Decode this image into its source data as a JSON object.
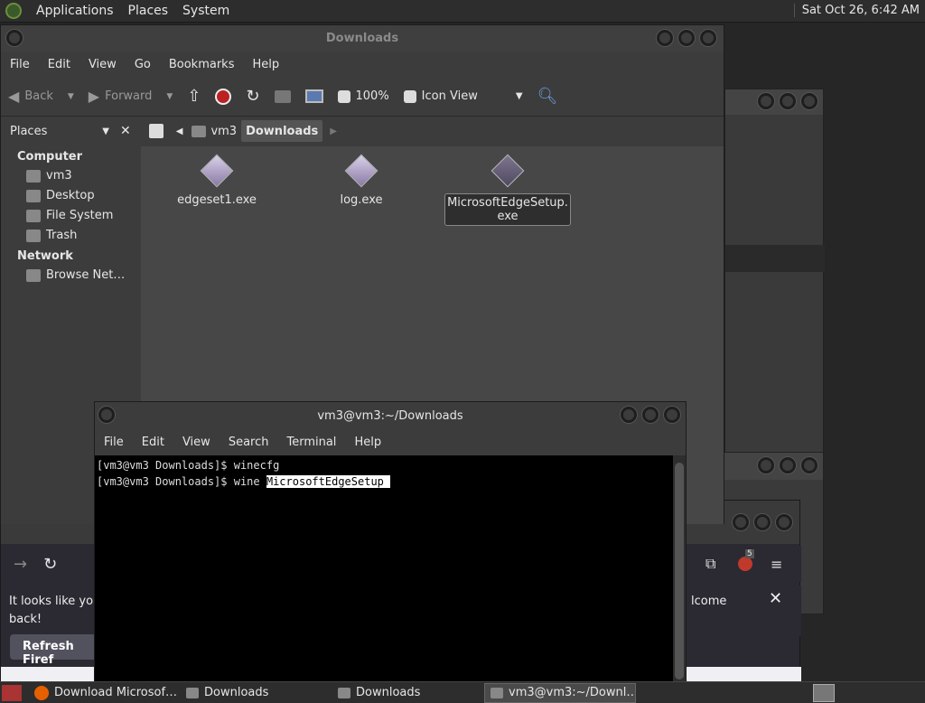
{
  "topbar": {
    "menus": [
      "Applications",
      "Places",
      "System"
    ],
    "clock": "Sat Oct 26,  6:42 AM"
  },
  "filemanager": {
    "title": "Downloads",
    "menus": [
      "File",
      "Edit",
      "View",
      "Go",
      "Bookmarks",
      "Help"
    ],
    "toolbar": {
      "back": "Back",
      "forward": "Forward",
      "zoom": "100%",
      "view": "Icon View"
    },
    "places_label": "Places",
    "crumbs": [
      "vm3",
      "Downloads"
    ],
    "sidebar": {
      "computer": "Computer",
      "items": [
        "vm3",
        "Desktop",
        "File System",
        "Trash"
      ],
      "network": "Network",
      "net_items": [
        "Browse Net…"
      ]
    },
    "files": [
      {
        "name": "edgeset1.exe"
      },
      {
        "name": "log.exe"
      },
      {
        "name": "MicrosoftEdgeSetup.exe"
      }
    ]
  },
  "terminal": {
    "title": "vm3@vm3:~/Downloads",
    "menus": [
      "File",
      "Edit",
      "View",
      "Search",
      "Terminal",
      "Help"
    ],
    "line1": "[vm3@vm3 Downloads]$ winecfg",
    "line2_prefix": "[vm3@vm3 Downloads]$ wine ",
    "line2_sel": "MicrosoftEdgeSetup"
  },
  "firefox": {
    "notice1": "It looks like you",
    "notice2": "back!",
    "notice_right": "lcome",
    "refresh": "Refresh Firef",
    "badge": "5"
  },
  "taskbar": [
    "Download Microsof…",
    "Downloads",
    "Downloads",
    "vm3@vm3:~/Downl…"
  ]
}
